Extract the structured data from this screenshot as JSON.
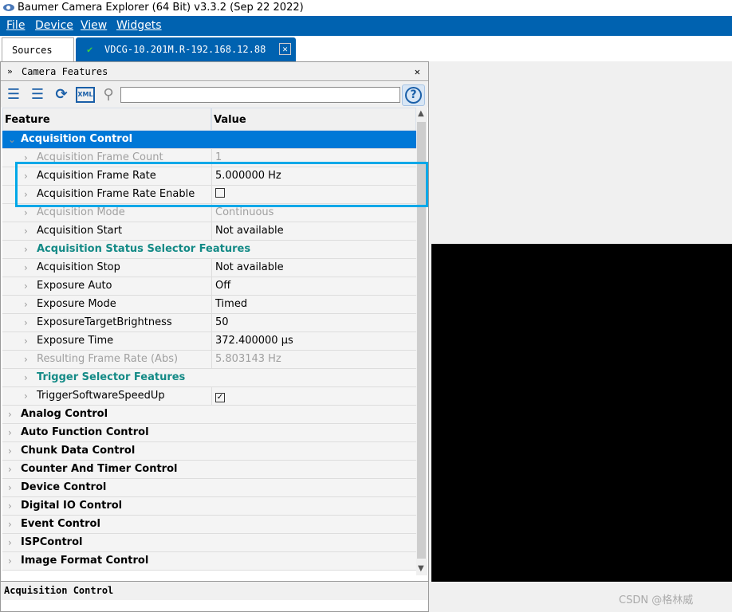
{
  "app": {
    "title": "Baumer Camera Explorer (64 Bit) v3.3.2 (Sep 22 2022)"
  },
  "menu": [
    "File",
    "Device",
    "View",
    "Widgets"
  ],
  "tabs": {
    "sources": "Sources",
    "device": "VDCG-10.201M.R-192.168.12.88"
  },
  "panel": {
    "title": "Camera Features",
    "search_value": ""
  },
  "columns": {
    "feature": "Feature",
    "value": "Value"
  },
  "rows": [
    {
      "f": "Acquisition Control",
      "v": "",
      "t": "top sel",
      "a": "⌄"
    },
    {
      "f": "Acquisition Frame Count",
      "v": "1",
      "t": "dis"
    },
    {
      "f": "Acquisition Frame Rate",
      "v": "5.000000 Hz",
      "t": ""
    },
    {
      "f": "Acquisition Frame Rate Enable",
      "v": "",
      "t": "",
      "cb": false
    },
    {
      "f": "Acquisition Mode",
      "v": "Continuous",
      "t": "dis"
    },
    {
      "f": "Acquisition Start",
      "v": "Not available",
      "t": ""
    },
    {
      "f": "Acquisition Status Selector Features",
      "v": "",
      "t": "sub"
    },
    {
      "f": "Acquisition Stop",
      "v": "Not available",
      "t": ""
    },
    {
      "f": "Exposure Auto",
      "v": "Off",
      "t": ""
    },
    {
      "f": "Exposure Mode",
      "v": "Timed",
      "t": ""
    },
    {
      "f": "ExposureTargetBrightness",
      "v": "50",
      "t": ""
    },
    {
      "f": "Exposure Time",
      "v": "372.400000 µs",
      "t": ""
    },
    {
      "f": "Resulting Frame Rate (Abs)",
      "v": "5.803143 Hz",
      "t": "dis"
    },
    {
      "f": "Trigger Selector Features",
      "v": "",
      "t": "sub"
    },
    {
      "f": "TriggerSoftwareSpeedUp",
      "v": "",
      "t": "",
      "cb": true
    },
    {
      "f": "Analog Control",
      "v": "",
      "t": "top"
    },
    {
      "f": "Auto Function Control",
      "v": "",
      "t": "top"
    },
    {
      "f": "Chunk Data Control",
      "v": "",
      "t": "top"
    },
    {
      "f": "Counter And Timer Control",
      "v": "",
      "t": "top"
    },
    {
      "f": "Device Control",
      "v": "",
      "t": "top"
    },
    {
      "f": "Digital IO Control",
      "v": "",
      "t": "top"
    },
    {
      "f": "Event Control",
      "v": "",
      "t": "top"
    },
    {
      "f": "ISPControl",
      "v": "",
      "t": "top"
    },
    {
      "f": "Image Format Control",
      "v": "",
      "t": "top"
    }
  ],
  "status_text": "Acquisition Control",
  "watermark": "CSDN @格林威",
  "colors": {
    "accent": "#0062b0",
    "selection": "#0078d7",
    "highlight_box": "#00a8e8",
    "subcategory": "#138a86"
  }
}
